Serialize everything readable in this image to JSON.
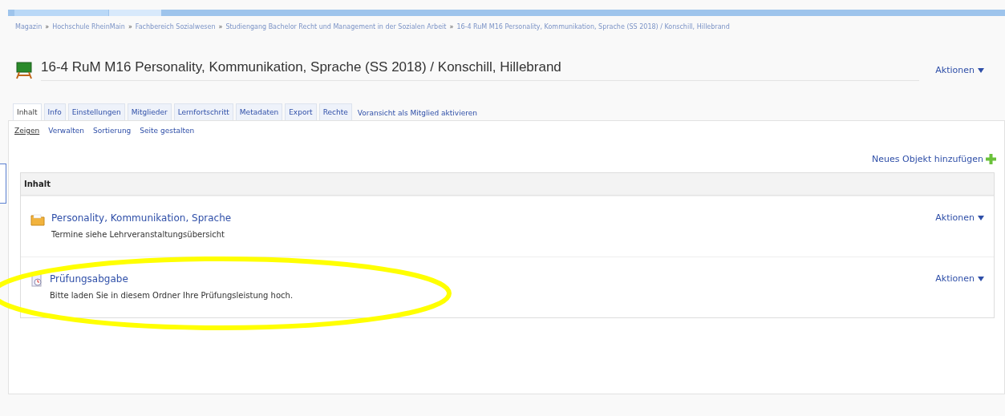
{
  "breadcrumb": {
    "separator": "»",
    "items": [
      "Magazin",
      "Hochschule RheinMain",
      "Fachbereich Sozialwesen",
      "Studiengang Bachelor Recht und Management in der Sozialen Arbeit",
      "16-4 RuM M16 Personality, Kommunikation, Sprache (SS 2018) / Konschill, Hillebrand"
    ]
  },
  "header": {
    "title": "16-4 RuM M16 Personality, Kommunikation, Sprache (SS 2018) / Konschill, Hillebrand",
    "actions": "Aktionen"
  },
  "tabs": [
    {
      "label": "Inhalt",
      "selected": true
    },
    {
      "label": "Info",
      "selected": false
    },
    {
      "label": "Einstellungen",
      "selected": false
    },
    {
      "label": "Mitglieder",
      "selected": false
    },
    {
      "label": "Lernfortschritt",
      "selected": false
    },
    {
      "label": "Metadaten",
      "selected": false
    },
    {
      "label": "Export",
      "selected": false
    },
    {
      "label": "Rechte",
      "selected": false
    }
  ],
  "tab_link": "Voransicht als Mitglied aktivieren",
  "subtabs": [
    {
      "label": "Zeigen",
      "selected": true
    },
    {
      "label": "Verwalten",
      "selected": false
    },
    {
      "label": "Sortierung",
      "selected": false
    },
    {
      "label": "Seite gestalten",
      "selected": false
    }
  ],
  "add_object": "Neues Objekt hinzufügen",
  "content": {
    "heading": "Inhalt",
    "items": [
      {
        "kind": "folder",
        "title": "Personality, Kommunikation, Sprache",
        "description": "Termine siehe Lehrveranstaltungsübersicht",
        "actions": "Aktionen",
        "highlighted": false
      },
      {
        "kind": "exercise",
        "title": "Prüfungsabgabe",
        "description": "Bitte laden Sie in diesem Ordner Ihre Prüfungsleistung hoch.",
        "actions": "Aktionen",
        "highlighted": true
      }
    ]
  }
}
